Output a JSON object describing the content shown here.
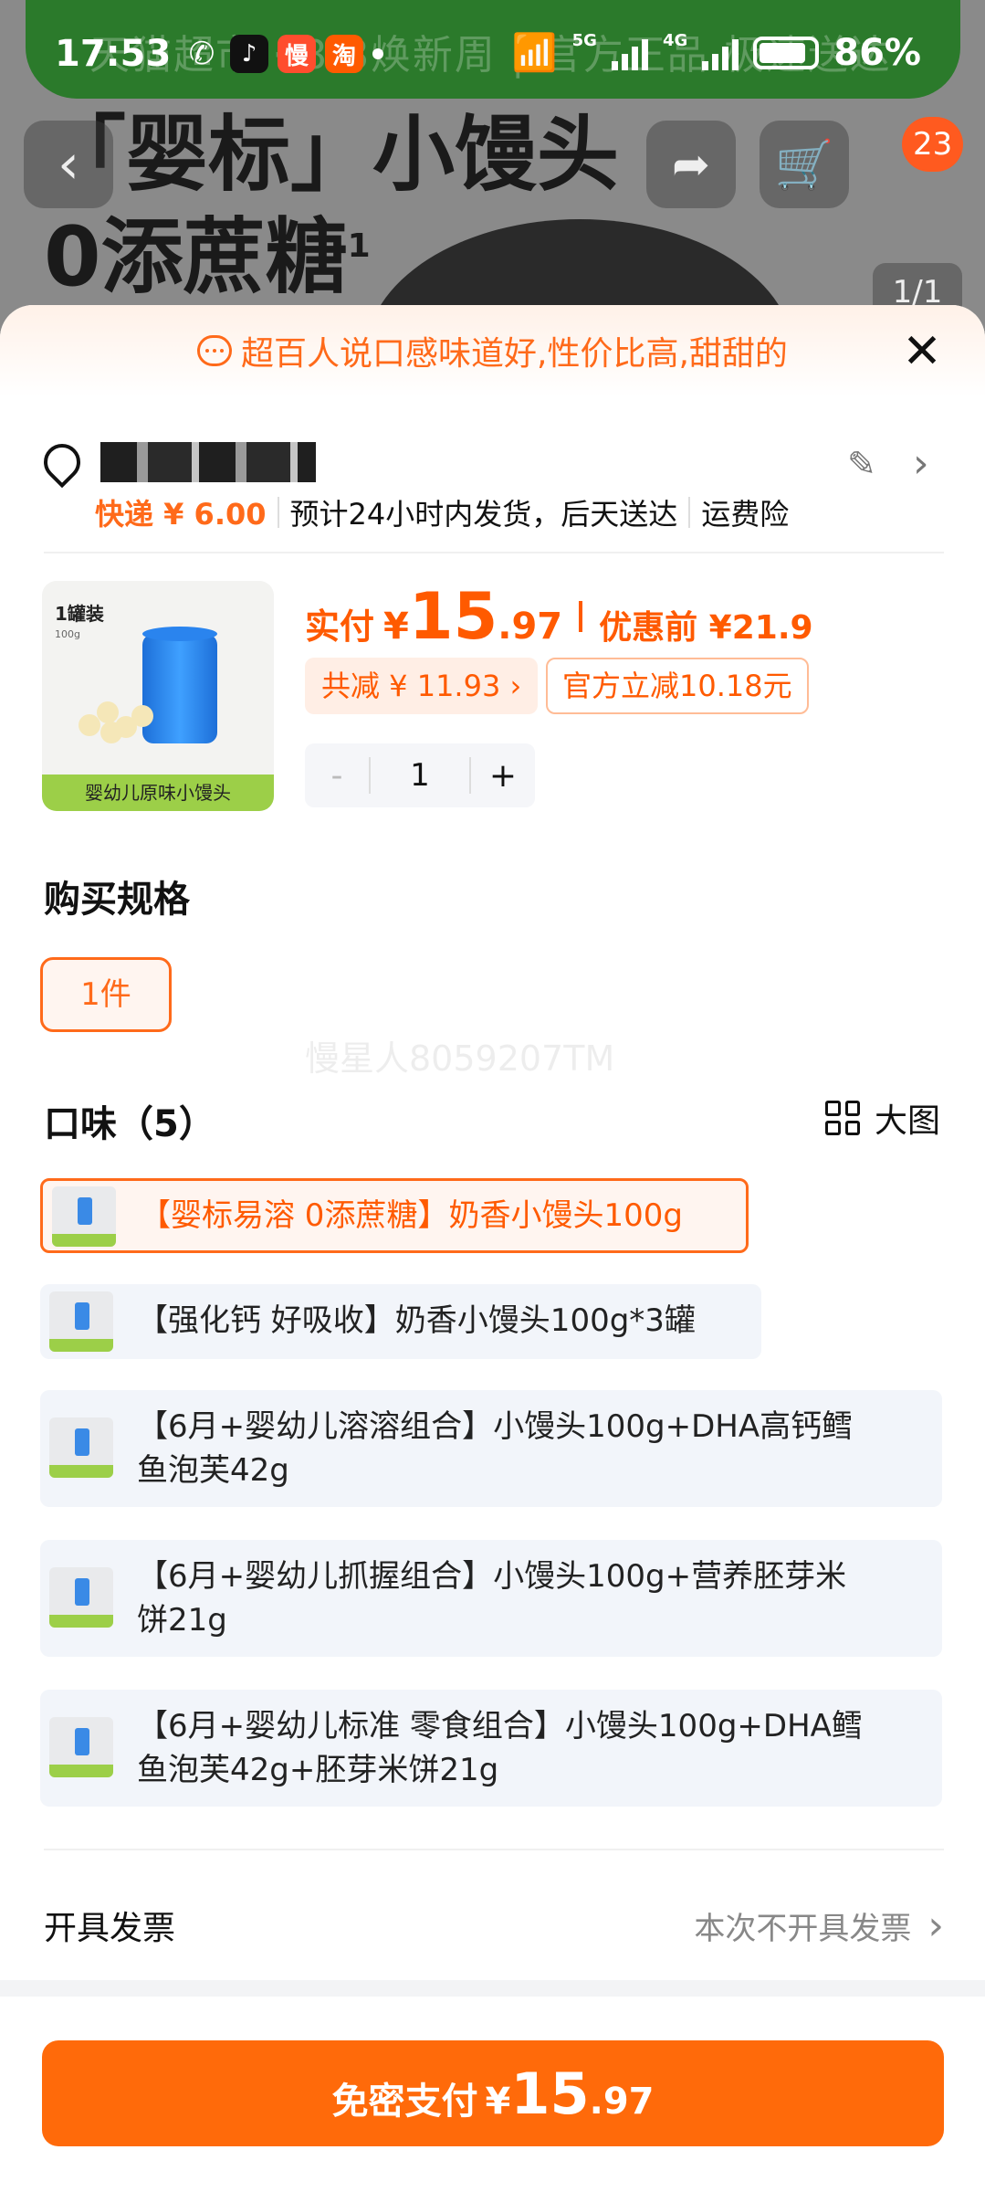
{
  "status_bar": {
    "time": "17:53",
    "net_5g": "5G",
    "net_4g": "4G",
    "battery": "86%",
    "battery_level": 0.86
  },
  "background_page": {
    "promo_text": "天猫超市 · 8·8焕新周 | 官方正品 极速送达",
    "title_line1": "「婴标」小馒头",
    "title_line2": "0添蔗糖",
    "title_sup": "1",
    "cart_count": "23",
    "page_indicator": "1/1"
  },
  "sheet": {
    "review_banner": "超百人说口感味道好,性价比高,甜甜的",
    "address": {
      "shipping_fee": "快递 ¥ 6.00",
      "dispatch_note": "预计24小时内发货，后天送达",
      "insurance": "运费险"
    },
    "product": {
      "pack_label": "1罐装",
      "pack_sub": "100g",
      "thumb_caption": "婴幼儿原味小馒头",
      "pay_label": "实付",
      "currency": "¥",
      "price_int": "15",
      "price_dec": ".97",
      "before_label": "优惠前 ¥21.9",
      "total_saving": "共减 ¥ 11.93 ›",
      "official_off": "官方立减10.18元",
      "qty_minus": "-",
      "quantity": "1",
      "qty_plus": "+"
    },
    "spec": {
      "title": "购买规格",
      "selected": "1件"
    },
    "watermark": "慢星人8059207TM",
    "flavor": {
      "title": "口味（5）",
      "big_view_label": "大图",
      "options": [
        {
          "label": "【婴标易溶 0添蔗糖】奶香小馒头100g",
          "selected": true
        },
        {
          "label": "【强化钙 好吸收】奶香小馒头100g*3罐",
          "selected": false
        },
        {
          "label_line1": "【6月+婴幼儿溶溶组合】小馒头100g+DHA高钙鳕",
          "label_line2": "鱼泡芙42g",
          "selected": false
        },
        {
          "label_line1": "【6月+婴幼儿抓握组合】小馒头100g+营养胚芽米",
          "label_line2": "饼21g",
          "selected": false
        },
        {
          "label_line1": "【6月+婴幼儿标准 零食组合】小馒头100g+DHA鳕",
          "label_line2": "鱼泡芙42g+胚芽米饼21g",
          "selected": false
        }
      ]
    },
    "invoice": {
      "label": "开具发票",
      "value": "本次不开具发票"
    },
    "pay_button": {
      "label": "免密支付",
      "currency": "¥",
      "price_int": "15",
      "price_dec": ".97"
    }
  },
  "colors": {
    "accent": "#ff6a0a",
    "price": "#ff5a00",
    "option_bg": "#f2f5fa"
  }
}
